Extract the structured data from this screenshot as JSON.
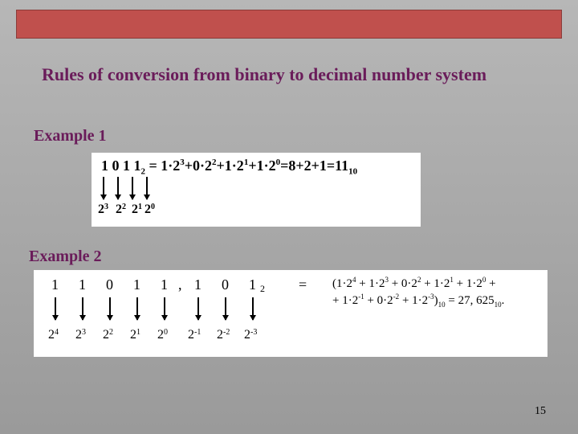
{
  "colors": {
    "accent_bar": "#c0504d",
    "heading": "#6a1c5a"
  },
  "title": "Rules of conversion from binary to decimal number system",
  "example1": {
    "label": "Example 1",
    "binary_digits": [
      "1",
      "0",
      "1",
      "1"
    ],
    "binary_base_sub": "2",
    "expansion": "1·2³+0·2²+1·2¹+1·2⁰=8+2+1=11",
    "result_base_sub": "10",
    "weights": [
      "2³",
      "2²",
      "2¹",
      "2⁰"
    ]
  },
  "example2": {
    "label": "Example 2",
    "digits_int": [
      "1",
      "1",
      "0",
      "1",
      "1"
    ],
    "separator": ",",
    "digits_frac": [
      "1",
      "0",
      "1"
    ],
    "binary_base_sub": "2",
    "equals": "=",
    "expansion_line1": "(1·2⁴ + 1·2³ + 0·2² + 1·2¹ + 1·2⁰ +",
    "expansion_line2": "+ 1·2⁻¹ + 0·2⁻² + 1·2⁻³)₁₀ = 27, 625₁₀.",
    "weights": [
      "2⁴",
      "2³",
      "2²",
      "2¹",
      "2⁰",
      "2⁻¹",
      "2⁻²",
      "2⁻³"
    ]
  },
  "page_number": "15"
}
